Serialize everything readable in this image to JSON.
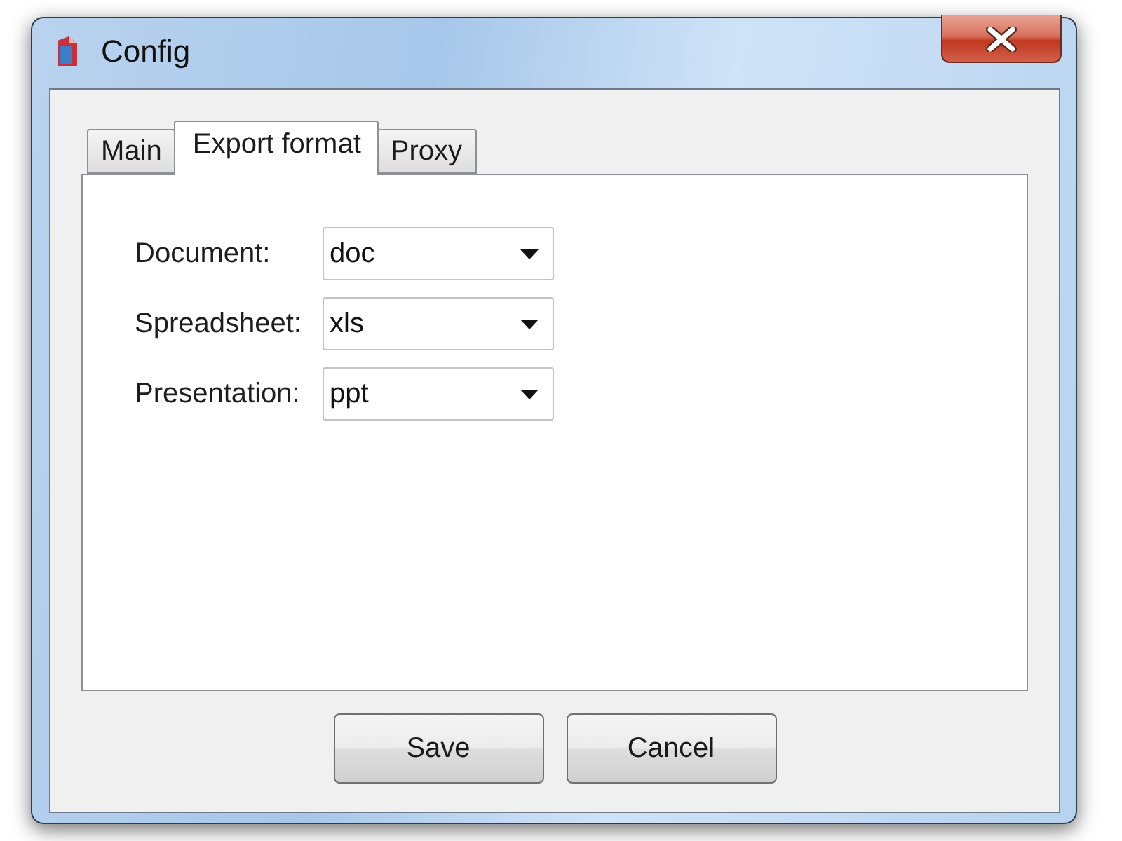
{
  "window": {
    "title": "Config"
  },
  "tabs": [
    {
      "label": "Main",
      "selected": false
    },
    {
      "label": "Export format",
      "selected": true
    },
    {
      "label": "Proxy",
      "selected": false
    }
  ],
  "fields": [
    {
      "label": "Document:",
      "value": "doc"
    },
    {
      "label": "Spreadsheet:",
      "value": "xls"
    },
    {
      "label": "Presentation:",
      "value": "ppt"
    }
  ],
  "buttons": [
    "Save",
    "Cancel"
  ]
}
